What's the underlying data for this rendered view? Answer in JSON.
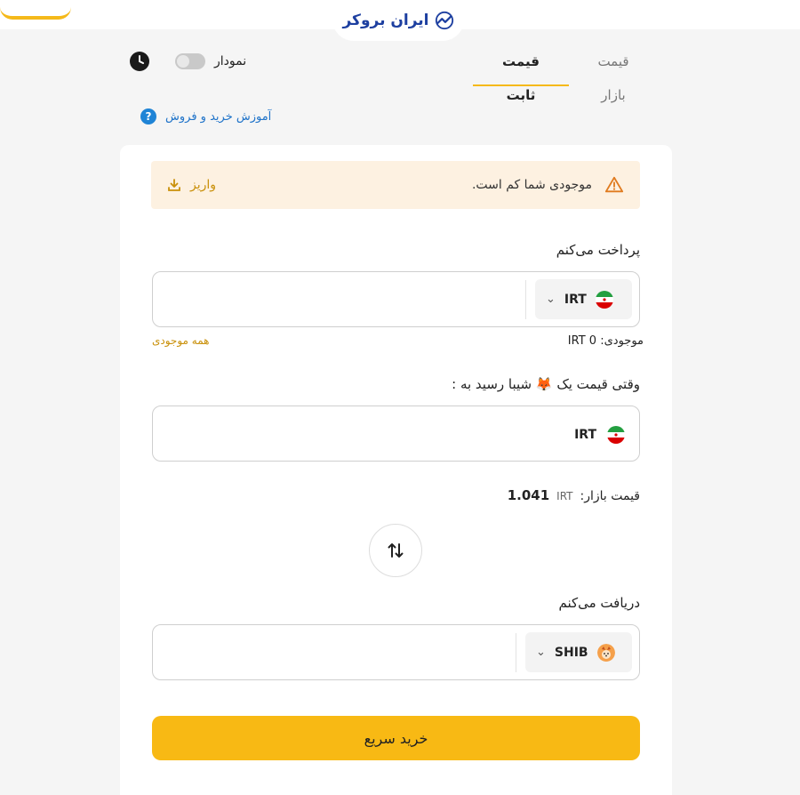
{
  "brand": {
    "logo_text": "ایران بروکر"
  },
  "tabs": {
    "market": "قیمت بازار",
    "fixed": "قیمت ثابت"
  },
  "chart_toggle": {
    "label": "نمودار",
    "enabled": false
  },
  "tutorial": {
    "help_glyph": "?",
    "text": "آموزش خرید و فروش"
  },
  "alert": {
    "message": "موجودی شما کم است.",
    "deposit_label": "واریز"
  },
  "pay": {
    "label": "پرداخت می‌کنم",
    "value": "",
    "currency": "IRT",
    "balance_label": "موجودی:",
    "balance_currency": "IRT",
    "balance_value": "0",
    "all_balance": "همه موجودی"
  },
  "target_price": {
    "label": "وقتی قیمت یک 🦊 شیبا رسید به :",
    "value": "",
    "currency": "IRT"
  },
  "market_price": {
    "label": "قیمت بازار:",
    "currency": "IRT",
    "value": "1.041"
  },
  "receive": {
    "label": "دریافت می‌کنم",
    "value": "",
    "currency": "SHIB"
  },
  "buy_button": "خرید سریع",
  "colors": {
    "accent": "#f8b914",
    "link": "#1f73c9",
    "warning_bg": "#fdf1e1",
    "warning_text": "#c9900a"
  },
  "icons": {
    "clock": "clock-icon",
    "help": "help-icon",
    "warning": "warning-icon",
    "download": "download-icon",
    "swap": "swap-icon"
  }
}
